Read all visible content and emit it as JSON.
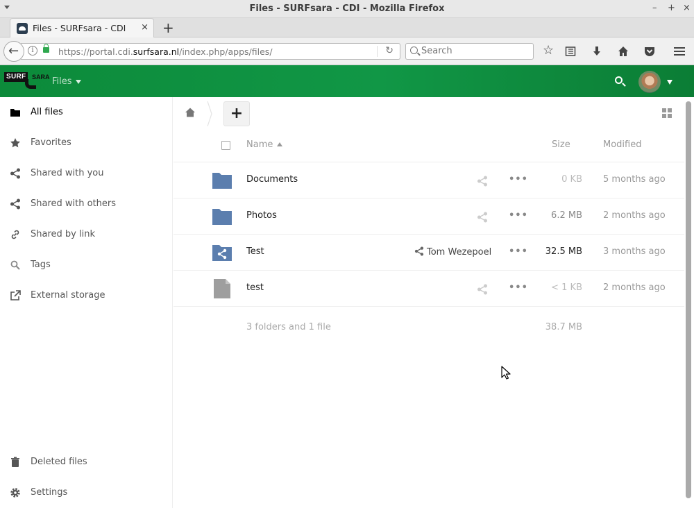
{
  "window": {
    "title": "Files - SURFsara - CDI - Mozilla Firefox",
    "controls": {
      "minimize": "–",
      "maximize": "+",
      "close": "×"
    }
  },
  "browser": {
    "tab": {
      "title": "Files - SURFsara - CDI",
      "close": "×"
    },
    "new_tab": "+",
    "url": {
      "prefix": "https://portal.cdi.",
      "domain": "surfsara.nl",
      "path": "/index.php/apps/files/"
    },
    "search_placeholder": "Search",
    "icons": [
      "bookmark-star-icon",
      "reading-list-icon",
      "download-icon",
      "home-icon",
      "pocket-icon",
      "hamburger-menu-icon"
    ]
  },
  "app_header": {
    "logo": {
      "left": "SURF",
      "right": "SARA"
    },
    "app_menu_label": "Files"
  },
  "sidebar": {
    "items": [
      {
        "label": "All files",
        "icon": "folder-icon",
        "active": true
      },
      {
        "label": "Favorites",
        "icon": "star-icon"
      },
      {
        "label": "Shared with you",
        "icon": "share-icon"
      },
      {
        "label": "Shared with others",
        "icon": "share-icon"
      },
      {
        "label": "Shared by link",
        "icon": "link-icon"
      },
      {
        "label": "Tags",
        "icon": "tag-search-icon"
      },
      {
        "label": "External storage",
        "icon": "external-link-icon"
      }
    ],
    "bottom_items": [
      {
        "label": "Deleted files",
        "icon": "trash-icon"
      },
      {
        "label": "Settings",
        "icon": "gear-icon"
      }
    ]
  },
  "files": {
    "columns": {
      "name": "Name",
      "size": "Size",
      "modified": "Modified"
    },
    "rows": [
      {
        "name": "Documents",
        "type": "folder",
        "size": "0 KB",
        "modified": "5 months ago",
        "shared_by": ""
      },
      {
        "name": "Photos",
        "type": "folder",
        "size": "6.2 MB",
        "modified": "2 months ago",
        "shared_by": ""
      },
      {
        "name": "Test",
        "type": "shared-folder",
        "size": "32.5 MB",
        "modified": "3 months ago",
        "shared_by": "Tom Wezepoel"
      },
      {
        "name": "test",
        "type": "file",
        "size": "< 1 KB",
        "modified": "2 months ago",
        "shared_by": ""
      }
    ],
    "row_action_dots": "•••",
    "summary": {
      "text": "3 folders and 1 file",
      "size": "38.7 MB"
    }
  },
  "colors": {
    "header_green": "#119746",
    "folder_blue": "#5b7eae",
    "file_gray": "#9e9e9e"
  }
}
